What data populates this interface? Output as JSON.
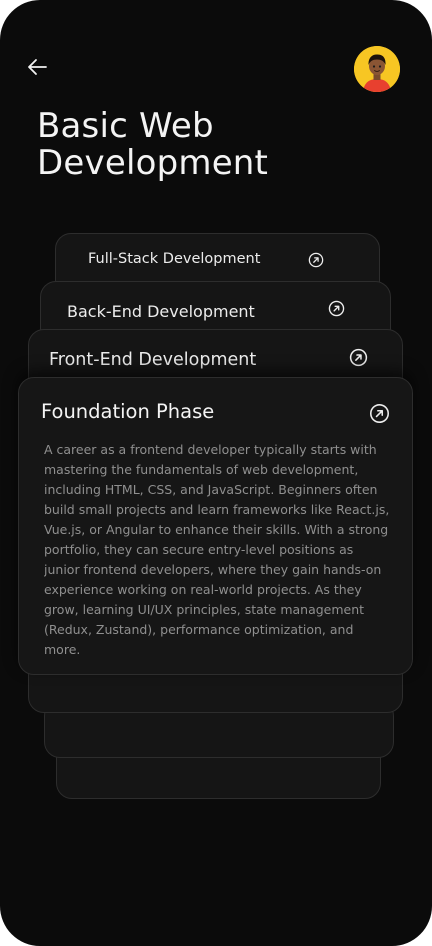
{
  "header": {
    "back_icon": "arrow-left-icon",
    "avatar_icon": "user-avatar"
  },
  "page": {
    "title": "Basic Web Development"
  },
  "cards": [
    {
      "label": "Full-Stack Development",
      "icon": "arrow-up-right-circle-icon"
    },
    {
      "label": "Back-End Development",
      "icon": "arrow-up-right-circle-icon"
    },
    {
      "label": "Front-End Development",
      "icon": "arrow-up-right-circle-icon"
    }
  ],
  "active_card": {
    "title": "Foundation Phase",
    "icon": "arrow-up-right-circle-icon",
    "description": "A career as a frontend developer typically starts with mastering the fundamentals of web development, including HTML, CSS, and JavaScript. Beginners often build small projects and learn frameworks like React.js, Vue.js, or Angular to enhance their skills. With a strong portfolio, they can secure entry-level positions as junior frontend developers, where they gain hands-on experience working on real-world projects. As they grow, learning UI/UX principles, state management (Redux, Zustand), performance optimization, and more."
  },
  "colors": {
    "background": "#0b0b0b",
    "card": "#151515",
    "card_border": "#2d2d2d",
    "text": "#f4f4f4",
    "muted_text": "#8f8f8f",
    "avatar_bg": "#f7c623"
  }
}
